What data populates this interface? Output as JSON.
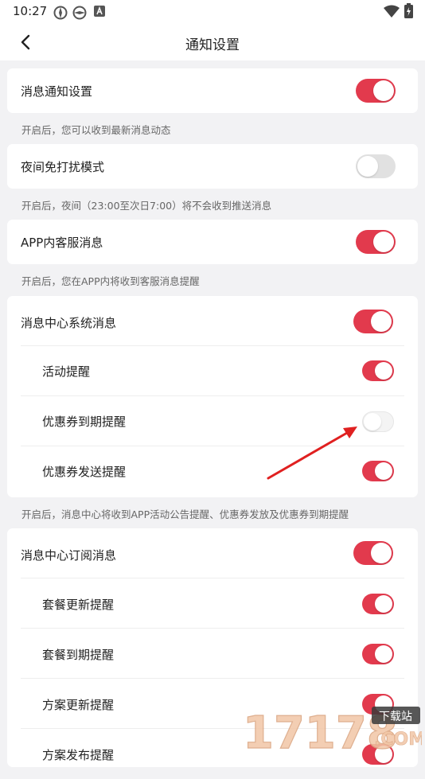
{
  "status_bar": {
    "time": "10:27"
  },
  "header": {
    "title": "通知设置"
  },
  "sections": {
    "message": {
      "label": "消息通知设置",
      "enabled": true,
      "caption": "开启后，您可以收到最新消息动态"
    },
    "night": {
      "label": "夜间免打扰模式",
      "enabled": false,
      "caption": "开启后，夜间（23:00至次日7:00）将不会收到推送消息"
    },
    "service": {
      "label": "APP内客服消息",
      "enabled": true,
      "caption": "开启后，您在APP内将收到客服消息提醒"
    },
    "system": {
      "label": "消息中心系统消息",
      "enabled": true,
      "items": [
        {
          "label": "活动提醒",
          "enabled": true
        },
        {
          "label": "优惠券到期提醒",
          "enabled": false
        },
        {
          "label": "优惠券发送提醒",
          "enabled": true
        }
      ],
      "caption": "开启后，消息中心将收到APP活动公告提醒、优惠券发放及优惠券到期提醒"
    },
    "subscribe": {
      "label": "消息中心订阅消息",
      "enabled": true,
      "items": [
        {
          "label": "套餐更新提醒",
          "enabled": true
        },
        {
          "label": "套餐到期提醒",
          "enabled": true
        },
        {
          "label": "方案更新提醒",
          "enabled": true
        },
        {
          "label": "方案发布提醒",
          "enabled": true
        }
      ]
    }
  },
  "watermark": {
    "text": "17178",
    "badge": "下载站",
    "domain": ".COM"
  },
  "colors": {
    "accent": "#e23a4d",
    "arrow": "#e02020"
  }
}
